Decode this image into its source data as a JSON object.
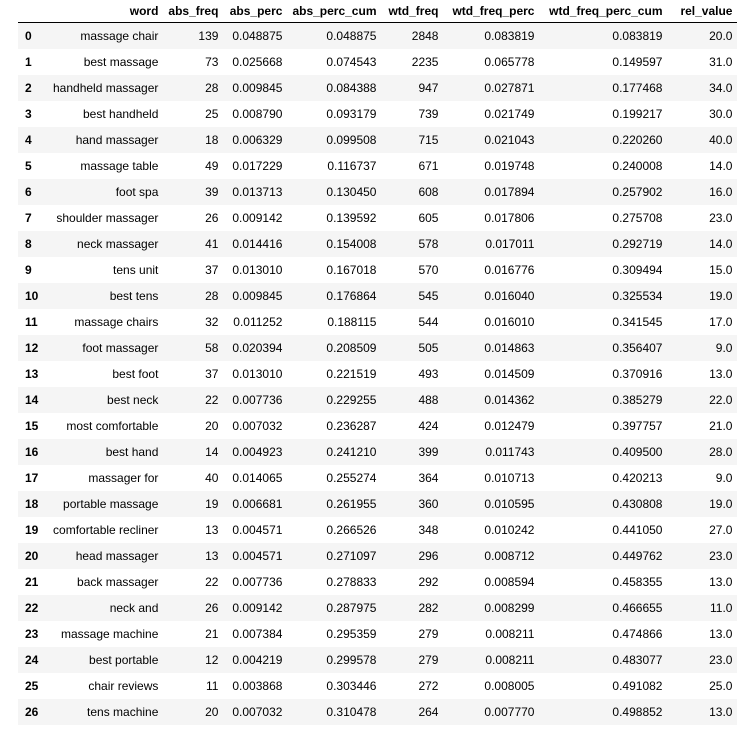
{
  "table": {
    "columns": [
      "word",
      "abs_freq",
      "abs_perc",
      "abs_perc_cum",
      "wtd_freq",
      "wtd_freq_perc",
      "wtd_freq_perc_cum",
      "rel_value"
    ],
    "rows": [
      {
        "index": "0",
        "word": "massage chair",
        "abs_freq": "139",
        "abs_perc": "0.048875",
        "abs_perc_cum": "0.048875",
        "wtd_freq": "2848",
        "wtd_freq_perc": "0.083819",
        "wtd_freq_perc_cum": "0.083819",
        "rel_value": "20.0"
      },
      {
        "index": "1",
        "word": "best massage",
        "abs_freq": "73",
        "abs_perc": "0.025668",
        "abs_perc_cum": "0.074543",
        "wtd_freq": "2235",
        "wtd_freq_perc": "0.065778",
        "wtd_freq_perc_cum": "0.149597",
        "rel_value": "31.0"
      },
      {
        "index": "2",
        "word": "handheld massager",
        "abs_freq": "28",
        "abs_perc": "0.009845",
        "abs_perc_cum": "0.084388",
        "wtd_freq": "947",
        "wtd_freq_perc": "0.027871",
        "wtd_freq_perc_cum": "0.177468",
        "rel_value": "34.0"
      },
      {
        "index": "3",
        "word": "best handheld",
        "abs_freq": "25",
        "abs_perc": "0.008790",
        "abs_perc_cum": "0.093179",
        "wtd_freq": "739",
        "wtd_freq_perc": "0.021749",
        "wtd_freq_perc_cum": "0.199217",
        "rel_value": "30.0"
      },
      {
        "index": "4",
        "word": "hand massager",
        "abs_freq": "18",
        "abs_perc": "0.006329",
        "abs_perc_cum": "0.099508",
        "wtd_freq": "715",
        "wtd_freq_perc": "0.021043",
        "wtd_freq_perc_cum": "0.220260",
        "rel_value": "40.0"
      },
      {
        "index": "5",
        "word": "massage table",
        "abs_freq": "49",
        "abs_perc": "0.017229",
        "abs_perc_cum": "0.116737",
        "wtd_freq": "671",
        "wtd_freq_perc": "0.019748",
        "wtd_freq_perc_cum": "0.240008",
        "rel_value": "14.0"
      },
      {
        "index": "6",
        "word": "foot spa",
        "abs_freq": "39",
        "abs_perc": "0.013713",
        "abs_perc_cum": "0.130450",
        "wtd_freq": "608",
        "wtd_freq_perc": "0.017894",
        "wtd_freq_perc_cum": "0.257902",
        "rel_value": "16.0"
      },
      {
        "index": "7",
        "word": "shoulder massager",
        "abs_freq": "26",
        "abs_perc": "0.009142",
        "abs_perc_cum": "0.139592",
        "wtd_freq": "605",
        "wtd_freq_perc": "0.017806",
        "wtd_freq_perc_cum": "0.275708",
        "rel_value": "23.0"
      },
      {
        "index": "8",
        "word": "neck massager",
        "abs_freq": "41",
        "abs_perc": "0.014416",
        "abs_perc_cum": "0.154008",
        "wtd_freq": "578",
        "wtd_freq_perc": "0.017011",
        "wtd_freq_perc_cum": "0.292719",
        "rel_value": "14.0"
      },
      {
        "index": "9",
        "word": "tens unit",
        "abs_freq": "37",
        "abs_perc": "0.013010",
        "abs_perc_cum": "0.167018",
        "wtd_freq": "570",
        "wtd_freq_perc": "0.016776",
        "wtd_freq_perc_cum": "0.309494",
        "rel_value": "15.0"
      },
      {
        "index": "10",
        "word": "best tens",
        "abs_freq": "28",
        "abs_perc": "0.009845",
        "abs_perc_cum": "0.176864",
        "wtd_freq": "545",
        "wtd_freq_perc": "0.016040",
        "wtd_freq_perc_cum": "0.325534",
        "rel_value": "19.0"
      },
      {
        "index": "11",
        "word": "massage chairs",
        "abs_freq": "32",
        "abs_perc": "0.011252",
        "abs_perc_cum": "0.188115",
        "wtd_freq": "544",
        "wtd_freq_perc": "0.016010",
        "wtd_freq_perc_cum": "0.341545",
        "rel_value": "17.0"
      },
      {
        "index": "12",
        "word": "foot massager",
        "abs_freq": "58",
        "abs_perc": "0.020394",
        "abs_perc_cum": "0.208509",
        "wtd_freq": "505",
        "wtd_freq_perc": "0.014863",
        "wtd_freq_perc_cum": "0.356407",
        "rel_value": "9.0"
      },
      {
        "index": "13",
        "word": "best foot",
        "abs_freq": "37",
        "abs_perc": "0.013010",
        "abs_perc_cum": "0.221519",
        "wtd_freq": "493",
        "wtd_freq_perc": "0.014509",
        "wtd_freq_perc_cum": "0.370916",
        "rel_value": "13.0"
      },
      {
        "index": "14",
        "word": "best neck",
        "abs_freq": "22",
        "abs_perc": "0.007736",
        "abs_perc_cum": "0.229255",
        "wtd_freq": "488",
        "wtd_freq_perc": "0.014362",
        "wtd_freq_perc_cum": "0.385279",
        "rel_value": "22.0"
      },
      {
        "index": "15",
        "word": "most comfortable",
        "abs_freq": "20",
        "abs_perc": "0.007032",
        "abs_perc_cum": "0.236287",
        "wtd_freq": "424",
        "wtd_freq_perc": "0.012479",
        "wtd_freq_perc_cum": "0.397757",
        "rel_value": "21.0"
      },
      {
        "index": "16",
        "word": "best hand",
        "abs_freq": "14",
        "abs_perc": "0.004923",
        "abs_perc_cum": "0.241210",
        "wtd_freq": "399",
        "wtd_freq_perc": "0.011743",
        "wtd_freq_perc_cum": "0.409500",
        "rel_value": "28.0"
      },
      {
        "index": "17",
        "word": "massager for",
        "abs_freq": "40",
        "abs_perc": "0.014065",
        "abs_perc_cum": "0.255274",
        "wtd_freq": "364",
        "wtd_freq_perc": "0.010713",
        "wtd_freq_perc_cum": "0.420213",
        "rel_value": "9.0"
      },
      {
        "index": "18",
        "word": "portable massage",
        "abs_freq": "19",
        "abs_perc": "0.006681",
        "abs_perc_cum": "0.261955",
        "wtd_freq": "360",
        "wtd_freq_perc": "0.010595",
        "wtd_freq_perc_cum": "0.430808",
        "rel_value": "19.0"
      },
      {
        "index": "19",
        "word": "comfortable recliner",
        "abs_freq": "13",
        "abs_perc": "0.004571",
        "abs_perc_cum": "0.266526",
        "wtd_freq": "348",
        "wtd_freq_perc": "0.010242",
        "wtd_freq_perc_cum": "0.441050",
        "rel_value": "27.0"
      },
      {
        "index": "20",
        "word": "head massager",
        "abs_freq": "13",
        "abs_perc": "0.004571",
        "abs_perc_cum": "0.271097",
        "wtd_freq": "296",
        "wtd_freq_perc": "0.008712",
        "wtd_freq_perc_cum": "0.449762",
        "rel_value": "23.0"
      },
      {
        "index": "21",
        "word": "back massager",
        "abs_freq": "22",
        "abs_perc": "0.007736",
        "abs_perc_cum": "0.278833",
        "wtd_freq": "292",
        "wtd_freq_perc": "0.008594",
        "wtd_freq_perc_cum": "0.458355",
        "rel_value": "13.0"
      },
      {
        "index": "22",
        "word": "neck and",
        "abs_freq": "26",
        "abs_perc": "0.009142",
        "abs_perc_cum": "0.287975",
        "wtd_freq": "282",
        "wtd_freq_perc": "0.008299",
        "wtd_freq_perc_cum": "0.466655",
        "rel_value": "11.0"
      },
      {
        "index": "23",
        "word": "massage machine",
        "abs_freq": "21",
        "abs_perc": "0.007384",
        "abs_perc_cum": "0.295359",
        "wtd_freq": "279",
        "wtd_freq_perc": "0.008211",
        "wtd_freq_perc_cum": "0.474866",
        "rel_value": "13.0"
      },
      {
        "index": "24",
        "word": "best portable",
        "abs_freq": "12",
        "abs_perc": "0.004219",
        "abs_perc_cum": "0.299578",
        "wtd_freq": "279",
        "wtd_freq_perc": "0.008211",
        "wtd_freq_perc_cum": "0.483077",
        "rel_value": "23.0"
      },
      {
        "index": "25",
        "word": "chair reviews",
        "abs_freq": "11",
        "abs_perc": "0.003868",
        "abs_perc_cum": "0.303446",
        "wtd_freq": "272",
        "wtd_freq_perc": "0.008005",
        "wtd_freq_perc_cum": "0.491082",
        "rel_value": "25.0"
      },
      {
        "index": "26",
        "word": "tens machine",
        "abs_freq": "20",
        "abs_perc": "0.007032",
        "abs_perc_cum": "0.310478",
        "wtd_freq": "264",
        "wtd_freq_perc": "0.007770",
        "wtd_freq_perc_cum": "0.498852",
        "rel_value": "13.0"
      }
    ]
  },
  "colors": {
    "row_stripe": "#f5f5f5",
    "row_plain": "#ffffff",
    "header_border": "#000000"
  }
}
